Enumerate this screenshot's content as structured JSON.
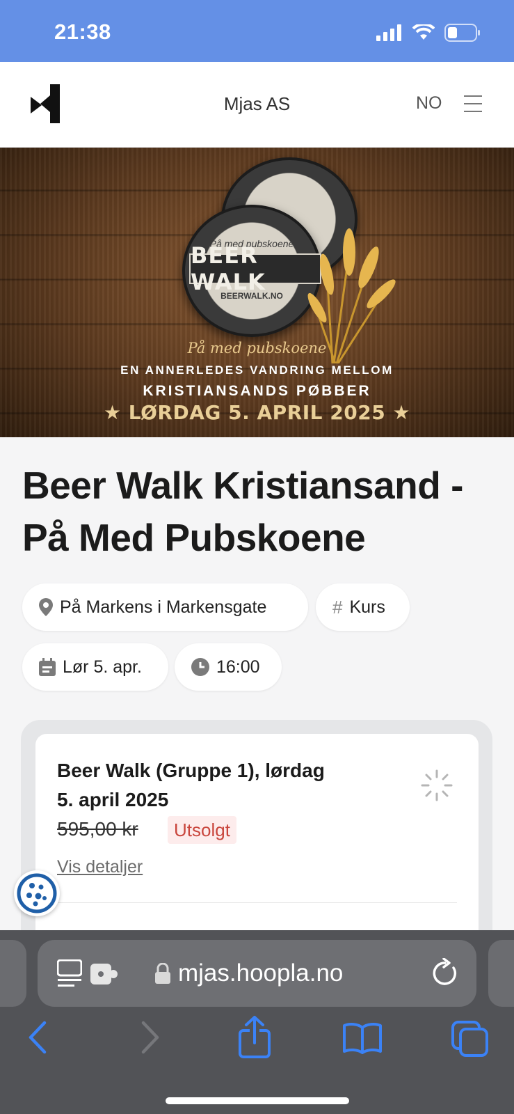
{
  "status_bar": {
    "time": "21:38"
  },
  "header": {
    "site_title": "Mjas AS",
    "language": "NO"
  },
  "hero": {
    "coaster_title": "BEER WALK",
    "coaster_subtitle": "På med pubskoene",
    "coaster_url": "BEERWALK.NO",
    "script_text": "På med pubskoene",
    "line1": "EN ANNERLEDES VANDRING MELLOM",
    "line2": "KRISTIANSANDS PØBBER",
    "date_banner": "★ LØRDAG 5. APRIL 2025 ★"
  },
  "event": {
    "title": "Beer Walk Kristiansand - På Med Pubskoene",
    "location": "På Markens i Markensgate",
    "category": "Kurs",
    "date": "Lør 5. apr.",
    "time": "16:00"
  },
  "ticket": {
    "name": "Beer Walk (Gruppe 1), lørdag 5. april 2025",
    "price": "595,00 kr",
    "status": "Utsolgt",
    "details_link": "Vis detaljer"
  },
  "browser": {
    "url": "mjas.hoopla.no"
  },
  "colors": {
    "status_bar": "#6490e6",
    "accent_blue": "#3b82f6",
    "sold_out": "#c9463d",
    "cookie_blue": "#1f5fa8"
  }
}
